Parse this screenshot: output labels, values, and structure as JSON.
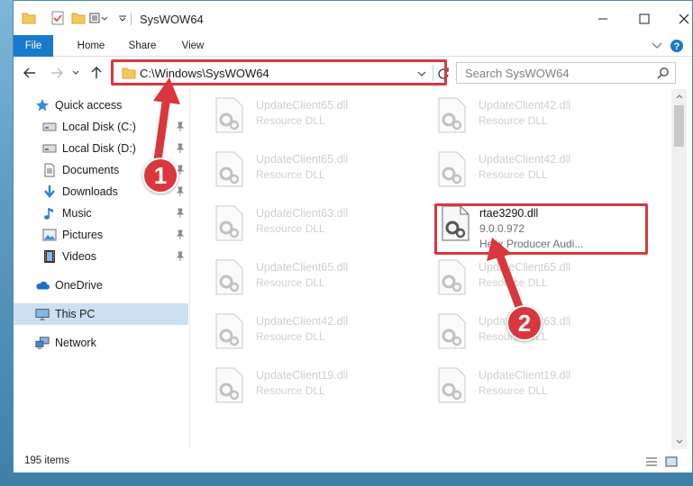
{
  "window": {
    "title": "SysWOW64",
    "quick_access_icons": [
      "folder-icon",
      "properties-icon",
      "new-folder-icon",
      "customize-icon"
    ]
  },
  "ribbon": {
    "tabs": [
      "File",
      "Home",
      "Share",
      "View"
    ]
  },
  "address_bar": {
    "path": "C:\\Windows\\SysWOW64"
  },
  "search": {
    "placeholder": "Search SysWOW64"
  },
  "sidebar": {
    "items": [
      {
        "label": "Quick access",
        "icon": "star-icon",
        "pinned": false
      },
      {
        "label": "Local Disk (C:)",
        "icon": "drive-icon",
        "pinned": true
      },
      {
        "label": "Local Disk (D:)",
        "icon": "drive-icon",
        "pinned": true
      },
      {
        "label": "Documents",
        "icon": "document-icon",
        "pinned": true
      },
      {
        "label": "Downloads",
        "icon": "download-icon",
        "pinned": true
      },
      {
        "label": "Music",
        "icon": "music-icon",
        "pinned": true
      },
      {
        "label": "Pictures",
        "icon": "pictures-icon",
        "pinned": true
      },
      {
        "label": "Videos",
        "icon": "videos-icon",
        "pinned": true
      },
      {
        "label": "OneDrive",
        "icon": "cloud-icon",
        "pinned": false
      },
      {
        "label": "This PC",
        "icon": "computer-icon",
        "pinned": false,
        "selected": true
      },
      {
        "label": "Network",
        "icon": "network-icon",
        "pinned": false
      }
    ]
  },
  "files": {
    "left_column": [
      {
        "name": "UpdateClient65.dll",
        "type": "Resource DLL"
      },
      {
        "name": "UpdateClient65.dll",
        "type": "Resource DLL"
      },
      {
        "name": "UpdateClient63.dll",
        "type": "Resource DLL"
      },
      {
        "name": "UpdateClient65.dll",
        "type": "Resource DLL"
      },
      {
        "name": "UpdateClient42.dll",
        "type": "Resource DLL"
      },
      {
        "name": "UpdateClient19.dll",
        "type": "Resource DLL"
      }
    ],
    "right_column": [
      {
        "name": "UpdateClient42.dll",
        "type": "Resource DLL"
      },
      {
        "name": "UpdateClient42.dll",
        "type": "Resource DLL"
      },
      {
        "name": "rtae3290.dll",
        "version": "9.0.0.972",
        "description": "Helix Producer Audi...",
        "highlighted": true
      },
      {
        "name": "UpdateClient65.dll",
        "type": "Resource DLL"
      },
      {
        "name": "UpdateClient63.dll",
        "type": "Resource DLL"
      },
      {
        "name": "UpdateClient19.dll",
        "type": "Resource DLL"
      }
    ]
  },
  "status": {
    "item_count": "195 items"
  },
  "annotations": {
    "step1": "1",
    "step2": "2",
    "color": "#d9373d"
  }
}
